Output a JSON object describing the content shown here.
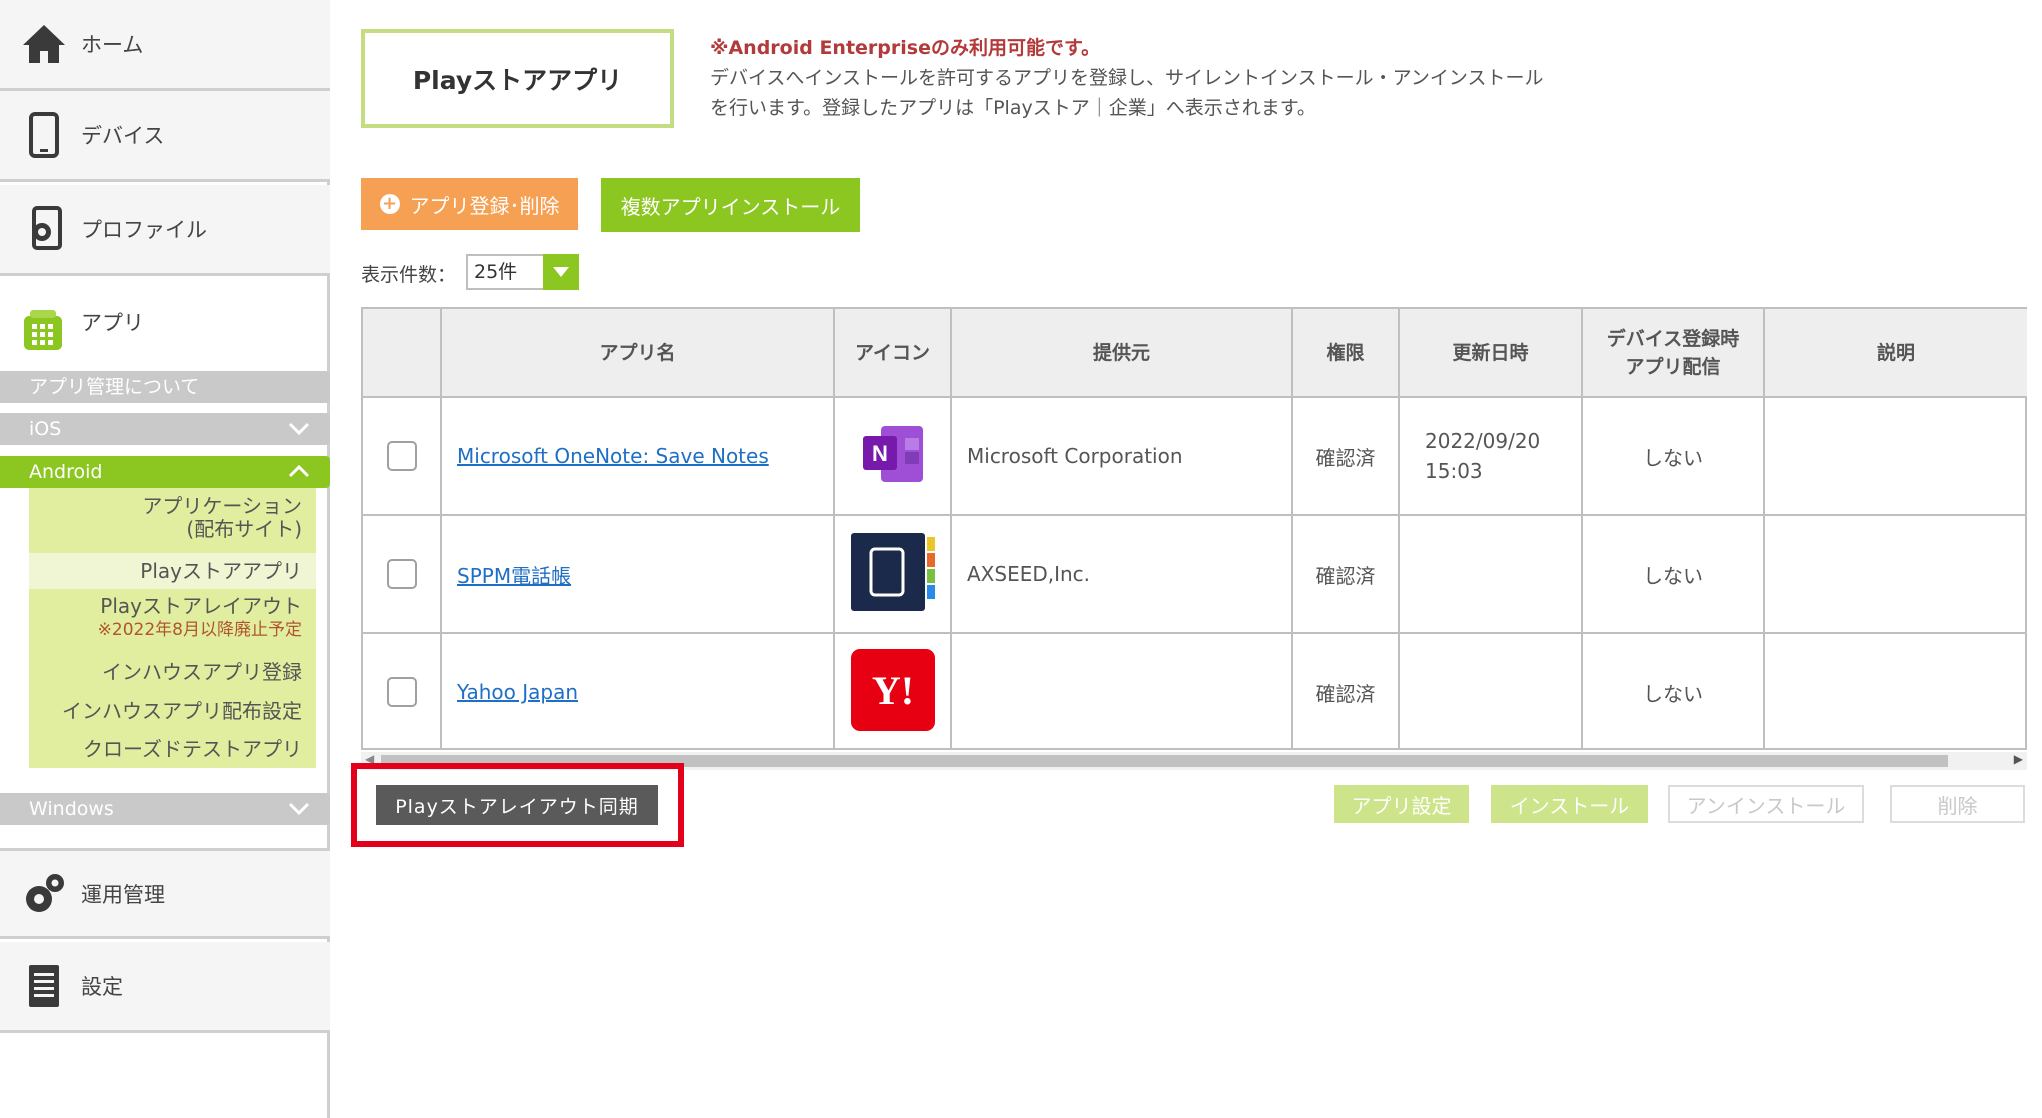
{
  "sidebar": {
    "home_label": "ホーム",
    "device_label": "デバイス",
    "profile_label": "プロファイル",
    "app_label": "アプリ",
    "about_label": "アプリ管理について",
    "ios_label": "iOS",
    "android_label": "Android",
    "android_items": [
      {
        "label": "アプリケーション\n(配布サイト)"
      },
      {
        "label": "Playストアアプリ"
      },
      {
        "label": "Playストアレイアウト",
        "note": "※2022年8月以降廃止予定"
      },
      {
        "label": "インハウスアプリ登録"
      },
      {
        "label": "インハウスアプリ配布設定"
      },
      {
        "label": "クローズドテストアプリ"
      }
    ],
    "windows_label": "Windows",
    "operations_label": "運用管理",
    "settings_label": "設定"
  },
  "page": {
    "title": "Playストアアプリ",
    "notice_title": "※Android Enterpriseのみ利用可能です。",
    "notice_body": "デバイスへインストールを許可するアプリを登録し、サイレントインストール・アンインストールを行います。登録したアプリは「Playストア｜企業」へ表示されます。"
  },
  "toolbar": {
    "register_label": "アプリ登録･削除",
    "multi_install_label": "複数アプリインストール",
    "per_page_label": "表示件数：",
    "per_page_value": "25件"
  },
  "table": {
    "headers": {
      "name": "アプリ名",
      "icon": "アイコン",
      "provider": "提供元",
      "permission": "権限",
      "updated": "更新日時",
      "distribution": "デバイス登録時\nアプリ配信",
      "description": "説明"
    },
    "rows": [
      {
        "name": "Microsoft OneNote: Save Notes",
        "icon": "onenote-icon",
        "provider": "Microsoft Corporation",
        "permission": "確認済",
        "updated_date": "2022/09/20",
        "updated_time": "15:03",
        "distribution": "しない",
        "description": ""
      },
      {
        "name": "SPPM電話帳",
        "icon": "sppm-icon",
        "provider": "AXSEED,Inc.",
        "permission": "確認済",
        "updated_date": "",
        "updated_time": "",
        "distribution": "しない",
        "description": ""
      },
      {
        "name": "Yahoo Japan",
        "icon": "yahoo-icon",
        "provider": "",
        "permission": "確認済",
        "updated_date": "",
        "updated_time": "",
        "distribution": "しない",
        "description": ""
      }
    ],
    "yahoo_logo_text": "Y!",
    "onenote_logo_text": "N"
  },
  "actions": {
    "sync_label": "Playストアレイアウト同期",
    "app_setting_label": "アプリ設定",
    "install_label": "インストール",
    "uninstall_label": "アンインストール",
    "delete_label": "削除"
  },
  "colors": {
    "accent_green": "#8cc621",
    "accent_orange": "#f6a054",
    "highlight_red": "#e3001b",
    "link_blue": "#1f6fc6",
    "notice_red": "#b33a3a"
  }
}
